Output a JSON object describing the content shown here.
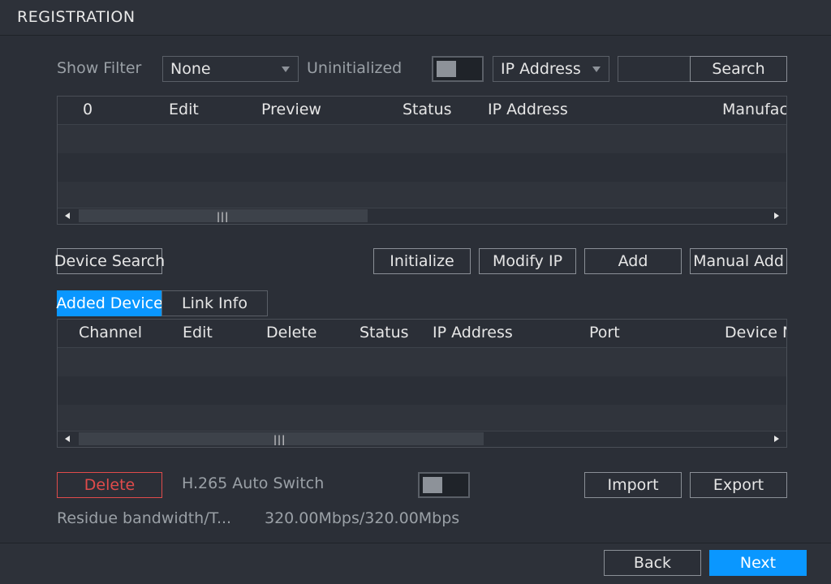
{
  "header": {
    "title": "REGISTRATION"
  },
  "filter": {
    "show_filter_label": "Show Filter",
    "show_filter_value": "None",
    "uninitialized_label": "Uninitialized",
    "uninitialized_on": false,
    "search_type_value": "IP Address",
    "search_input_value": "",
    "search_button": "Search"
  },
  "top_table": {
    "columns": [
      "0",
      "Edit",
      "Preview",
      "Status",
      "IP Address",
      "Manufac"
    ],
    "rows": []
  },
  "actions": {
    "device_search": "Device Search",
    "initialize": "Initialize",
    "modify_ip": "Modify IP",
    "add": "Add",
    "manual_add": "Manual Add"
  },
  "tabs": {
    "added_device": "Added Device",
    "link_info": "Link Info"
  },
  "bottom_table": {
    "columns": [
      "Channel",
      "Edit",
      "Delete",
      "Status",
      "IP Address",
      "Port",
      "Device N"
    ],
    "rows": []
  },
  "bottom": {
    "delete": "Delete",
    "h265_label": "H.265 Auto Switch",
    "h265_on": false,
    "import": "Import",
    "export": "Export",
    "bandwidth_label": "Residue bandwidth/T...",
    "bandwidth_value": "320.00Mbps/320.00Mbps"
  },
  "footer": {
    "back": "Back",
    "next": "Next"
  },
  "colors": {
    "background": "#2b2f37",
    "accent": "#0a97ff",
    "danger": "#e04b4b"
  },
  "icons": {
    "dropdown": "chevron-down-icon",
    "scroll_left": "arrow-left-icon",
    "scroll_right": "arrow-right-icon",
    "scroll_grip": "grip-icon"
  }
}
